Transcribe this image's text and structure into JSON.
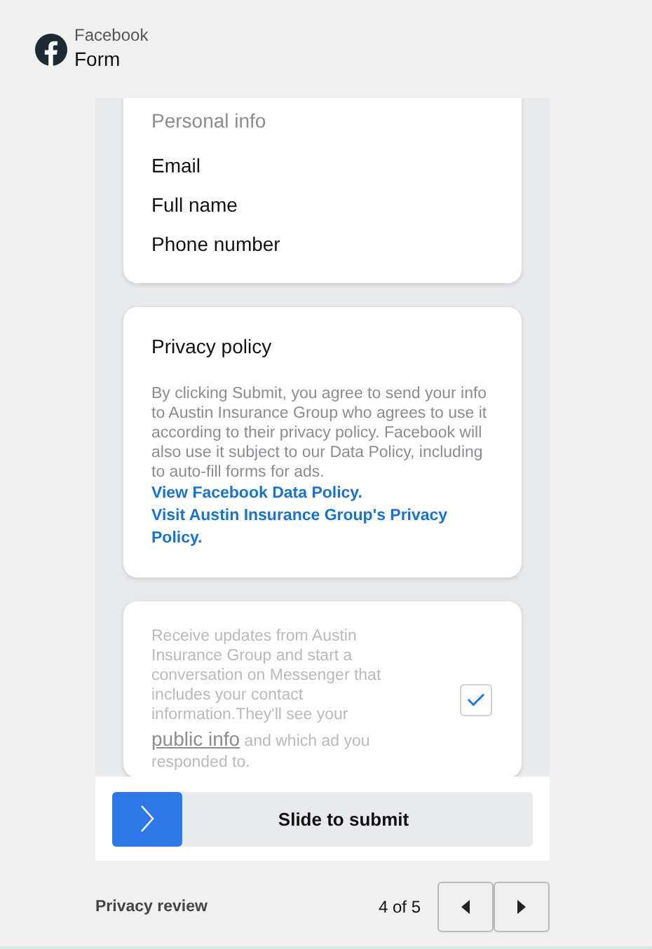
{
  "header": {
    "app": "Facebook",
    "title": "Form"
  },
  "personal_info": {
    "heading": "Personal info",
    "fields": [
      "Email",
      "Full name",
      "Phone number"
    ]
  },
  "privacy_policy": {
    "heading": "Privacy policy",
    "body": "By clicking Submit, you agree to send your info to Austin Insurance Group who agrees to use it according to their privacy policy. Facebook will also use it subject to our Data Policy, including to auto-fill forms for ads.",
    "links": [
      "View Facebook Data Policy.",
      "Visit Austin Insurance Group's Privacy Policy."
    ]
  },
  "messenger_optin": {
    "text_before": "Receive updates from Austin Insurance Group and start a conversation on Messenger that includes your contact information.They'll see your ",
    "link": "public info",
    "text_after": " and which ad you responded to.",
    "checked": true
  },
  "submit": {
    "label": "Slide to submit"
  },
  "footer": {
    "title": "Privacy review",
    "page": "4 of 5"
  }
}
